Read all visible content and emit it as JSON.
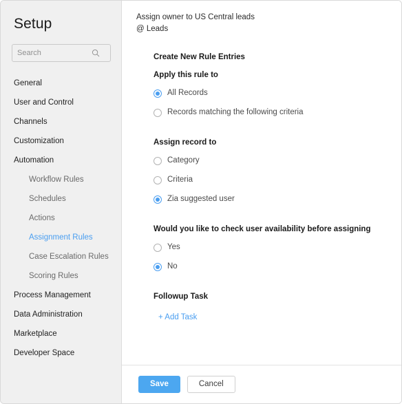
{
  "sidebar": {
    "title": "Setup",
    "search": {
      "placeholder": "Search",
      "value": "",
      "icon": "search-icon"
    },
    "items": [
      {
        "label": "General",
        "level": "top",
        "active": false
      },
      {
        "label": "User and Control",
        "level": "top",
        "active": false
      },
      {
        "label": "Channels",
        "level": "top",
        "active": false
      },
      {
        "label": "Customization",
        "level": "top",
        "active": false
      },
      {
        "label": "Automation",
        "level": "top",
        "active": false
      },
      {
        "label": "Workflow Rules",
        "level": "sub",
        "active": false
      },
      {
        "label": "Schedules",
        "level": "sub",
        "active": false
      },
      {
        "label": "Actions",
        "level": "sub",
        "active": false
      },
      {
        "label": "Assignment Rules",
        "level": "sub",
        "active": true
      },
      {
        "label": "Case Escalation Rules",
        "level": "sub",
        "active": false
      },
      {
        "label": "Scoring Rules",
        "level": "sub",
        "active": false
      },
      {
        "label": "Process Management",
        "level": "top",
        "active": false
      },
      {
        "label": "Data Administration",
        "level": "top",
        "active": false
      },
      {
        "label": "Marketplace",
        "level": "top",
        "active": false
      },
      {
        "label": "Developer Space",
        "level": "top",
        "active": false
      }
    ]
  },
  "main": {
    "rule_name": "Assign owner to US Central leads",
    "rule_module": "@ Leads",
    "form_title": "Create New Rule Entries",
    "sections": [
      {
        "title": "Apply this rule to",
        "options": [
          {
            "label": "All Records",
            "selected": true
          },
          {
            "label": "Records matching the following criteria",
            "selected": false
          }
        ]
      },
      {
        "title": "Assign record to",
        "options": [
          {
            "label": "Category",
            "selected": false
          },
          {
            "label": "Criteria",
            "selected": false
          },
          {
            "label": "Zia suggested user",
            "selected": true
          }
        ]
      },
      {
        "title": "Would you like to check user availability before assigning",
        "options": [
          {
            "label": "Yes",
            "selected": false
          },
          {
            "label": "No",
            "selected": true
          }
        ]
      }
    ],
    "followup": {
      "title": "Followup Task",
      "add_task_label": "+ Add Task"
    }
  },
  "footer": {
    "save_label": "Save",
    "cancel_label": "Cancel"
  },
  "colors": {
    "accent": "#4a9ef0",
    "primary_button": "#4ca7f0",
    "sidebar_bg": "#f0f0f0",
    "text": "#1a1a1a",
    "muted_text": "#6a6a6a"
  }
}
